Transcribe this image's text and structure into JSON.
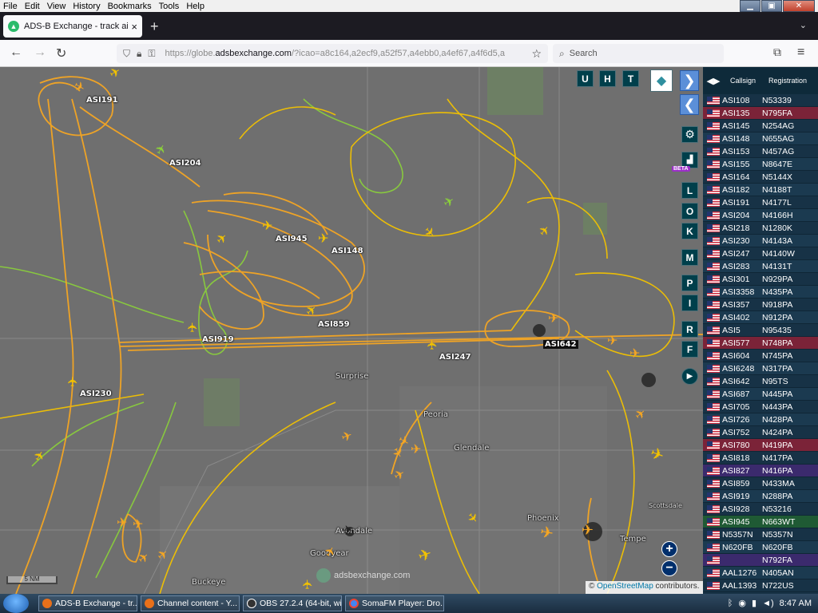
{
  "menu": [
    "File",
    "Edit",
    "View",
    "History",
    "Bookmarks",
    "Tools",
    "Help"
  ],
  "window_controls": {
    "minimize": "▁",
    "maximize": "▣",
    "close": "✕"
  },
  "tab": {
    "title": "ADS-B Exchange - track aircraft",
    "close": "×",
    "new_tab": "+",
    "list": "⌄"
  },
  "nav": {
    "back": "←",
    "forward": "→",
    "reload": "↻",
    "url_host": "https://globe.",
    "url_domain": "adsbexchange.com",
    "url_rest": "/?icao=a8c164,a2ecf9,a52f57,a4ebb0,a4ef67,a4f6d5,a",
    "search_placeholder": "Search",
    "bookmark": "☆",
    "extensions": "⧉",
    "menu": "≡"
  },
  "map": {
    "buttons_top": [
      "U",
      "H",
      "T"
    ],
    "side_buttons": [
      "L",
      "O",
      "K",
      "M",
      "P",
      "I",
      "R",
      "F"
    ],
    "beta": "BETA",
    "settings_icon": "⚙",
    "replay_icon": "▶",
    "layers_icon": "◆",
    "nav_right": "❯",
    "nav_left": "❮",
    "zoom_in": "+",
    "zoom_out": "−",
    "scale_label": "5 NM",
    "watermark": "adsbexchange.com",
    "attribution_prefix": "© ",
    "attribution_link": "OpenStreetMap",
    "attribution_suffix": " contributors.",
    "place_labels": [
      "Surprise",
      "Peoria",
      "Glendale",
      "Phoenix",
      "Scottsdale",
      "Tempe",
      "Buckeye",
      "Avondale",
      "Goodyear"
    ],
    "aircraft_labels": [
      "ASI191",
      "ASI204",
      "ASI945",
      "ASI148",
      "ASI859",
      "ASI919",
      "ASI247",
      "ASI642",
      "ASI230"
    ]
  },
  "table": {
    "toggle": "◀▶",
    "col_callsign": "Callsign",
    "col_registration": "Registration",
    "rows": [
      {
        "callsign": "ASI108",
        "reg": "N53339",
        "hl": ""
      },
      {
        "callsign": "ASI135",
        "reg": "N795FA",
        "hl": "red"
      },
      {
        "callsign": "ASI145",
        "reg": "N254AG",
        "hl": ""
      },
      {
        "callsign": "ASI148",
        "reg": "N655AG",
        "hl": ""
      },
      {
        "callsign": "ASI153",
        "reg": "N457AG",
        "hl": ""
      },
      {
        "callsign": "ASI155",
        "reg": "N8647E",
        "hl": ""
      },
      {
        "callsign": "ASI164",
        "reg": "N5144X",
        "hl": ""
      },
      {
        "callsign": "ASI182",
        "reg": "N4188T",
        "hl": ""
      },
      {
        "callsign": "ASI191",
        "reg": "N4177L",
        "hl": ""
      },
      {
        "callsign": "ASI204",
        "reg": "N4166H",
        "hl": ""
      },
      {
        "callsign": "ASI218",
        "reg": "N1280K",
        "hl": ""
      },
      {
        "callsign": "ASI230",
        "reg": "N4143A",
        "hl": ""
      },
      {
        "callsign": "ASI247",
        "reg": "N4140W",
        "hl": ""
      },
      {
        "callsign": "ASI283",
        "reg": "N4131T",
        "hl": ""
      },
      {
        "callsign": "ASI301",
        "reg": "N929PA",
        "hl": ""
      },
      {
        "callsign": "ASI3358",
        "reg": "N435PA",
        "hl": ""
      },
      {
        "callsign": "ASI357",
        "reg": "N918PA",
        "hl": ""
      },
      {
        "callsign": "ASI402",
        "reg": "N912PA",
        "hl": ""
      },
      {
        "callsign": "ASI5",
        "reg": "N95435",
        "hl": ""
      },
      {
        "callsign": "ASI577",
        "reg": "N748PA",
        "hl": "red"
      },
      {
        "callsign": "ASI604",
        "reg": "N745PA",
        "hl": ""
      },
      {
        "callsign": "ASI6248",
        "reg": "N317PA",
        "hl": ""
      },
      {
        "callsign": "ASI642",
        "reg": "N95TS",
        "hl": ""
      },
      {
        "callsign": "ASI687",
        "reg": "N445PA",
        "hl": ""
      },
      {
        "callsign": "ASI705",
        "reg": "N443PA",
        "hl": ""
      },
      {
        "callsign": "ASI726",
        "reg": "N428PA",
        "hl": ""
      },
      {
        "callsign": "ASI752",
        "reg": "N424PA",
        "hl": ""
      },
      {
        "callsign": "ASI780",
        "reg": "N419PA",
        "hl": "red"
      },
      {
        "callsign": "ASI818",
        "reg": "N417PA",
        "hl": ""
      },
      {
        "callsign": "ASI827",
        "reg": "N416PA",
        "hl": "purple"
      },
      {
        "callsign": "ASI859",
        "reg": "N433MA",
        "hl": ""
      },
      {
        "callsign": "ASI919",
        "reg": "N288PA",
        "hl": ""
      },
      {
        "callsign": "ASI928",
        "reg": "N53216",
        "hl": ""
      },
      {
        "callsign": "ASI945",
        "reg": "N663WT",
        "hl": "green"
      },
      {
        "callsign": "N5357N",
        "reg": "N5357N",
        "hl": ""
      },
      {
        "callsign": "N620FB",
        "reg": "N620FB",
        "hl": ""
      },
      {
        "callsign": "",
        "reg": "N792FA",
        "hl": "purple"
      },
      {
        "callsign": "AAL1276",
        "reg": "N405AN",
        "hl": ""
      },
      {
        "callsign": "AAL1393",
        "reg": "N722US",
        "hl": ""
      }
    ]
  },
  "taskbar": {
    "tasks": [
      {
        "label": "ADS-B Exchange - tr...",
        "color": "#e8701a"
      },
      {
        "label": "Channel content - Y...",
        "color": "#e8701a"
      },
      {
        "label": "OBS 27.2.4 (64-bit, wi...",
        "color": "#333333"
      },
      {
        "label": "SomaFM Player: Dro...",
        "color": "#4285f4"
      }
    ],
    "clock": "8:47 AM"
  },
  "colors": {
    "track_orange": "#f5a623",
    "track_yellow": "#f2c200",
    "track_green": "#8bd13a",
    "panel_bg": "#173246"
  }
}
